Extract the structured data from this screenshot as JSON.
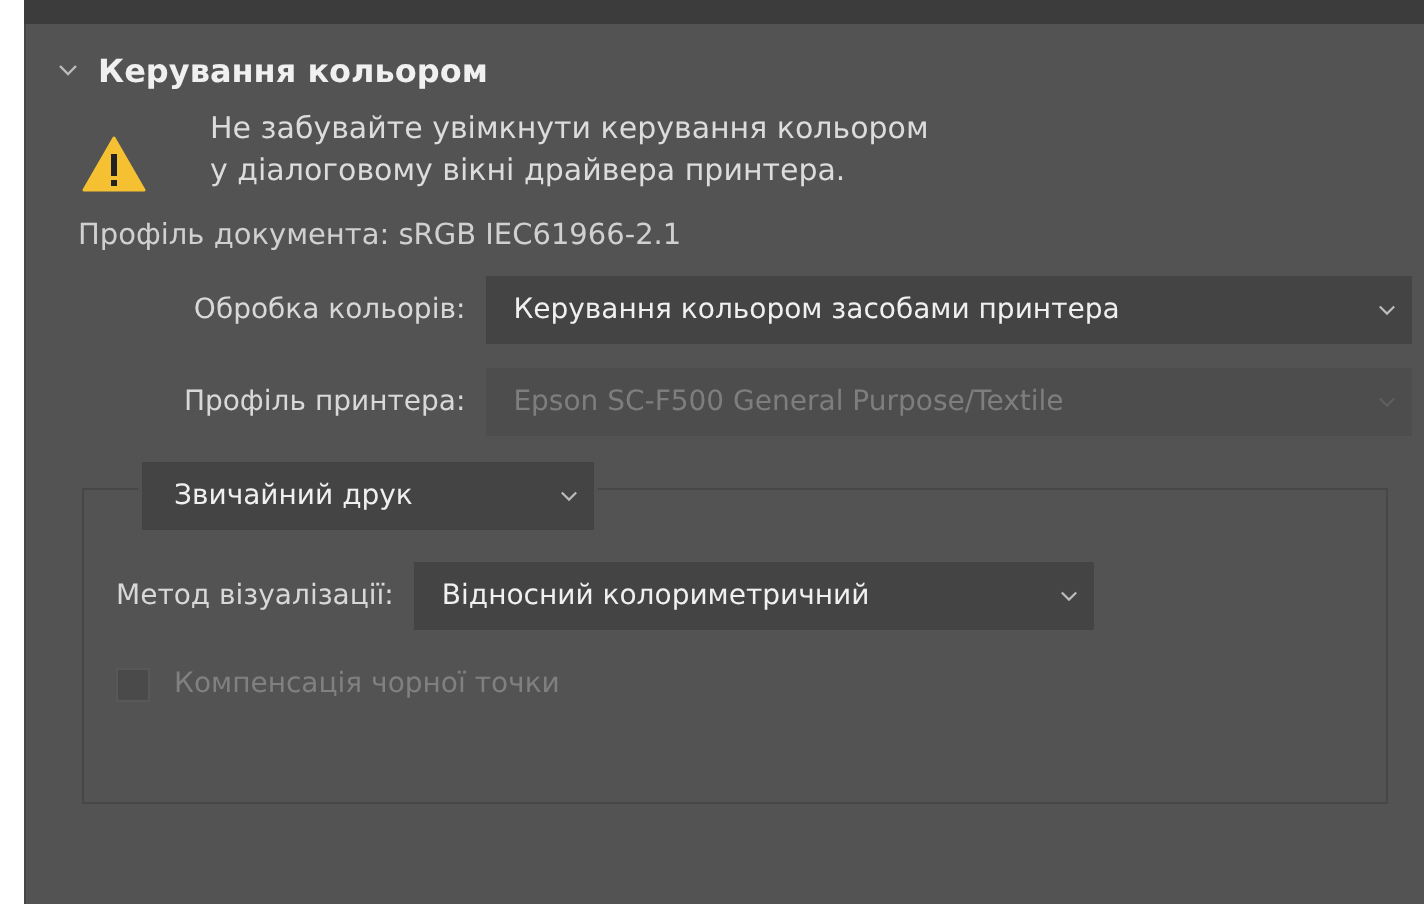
{
  "section": {
    "title": "Керування кольором",
    "expanded": true
  },
  "warning": {
    "lines": [
      "Не забувайте увімкнути керування кольором",
      "у діалоговому вікні драйвера принтера."
    ]
  },
  "document_profile": "Профіль документа: sRGB IEC61966-2.1",
  "fields": [
    {
      "label": "Обробка кольорів:",
      "value": "Керування кольором засобами принтера",
      "disabled": false
    },
    {
      "label": "Профіль принтера:",
      "value": "Epson SC-F500 General Purpose/Textile",
      "disabled": true
    }
  ],
  "group": {
    "mode": {
      "value": "Звичайний друк"
    },
    "rendering": {
      "label": "Метод візуалізації:",
      "value": "Відносний колориметричний"
    },
    "black_point": {
      "label": "Компенсація чорної точки",
      "checked": false,
      "disabled": true
    }
  }
}
